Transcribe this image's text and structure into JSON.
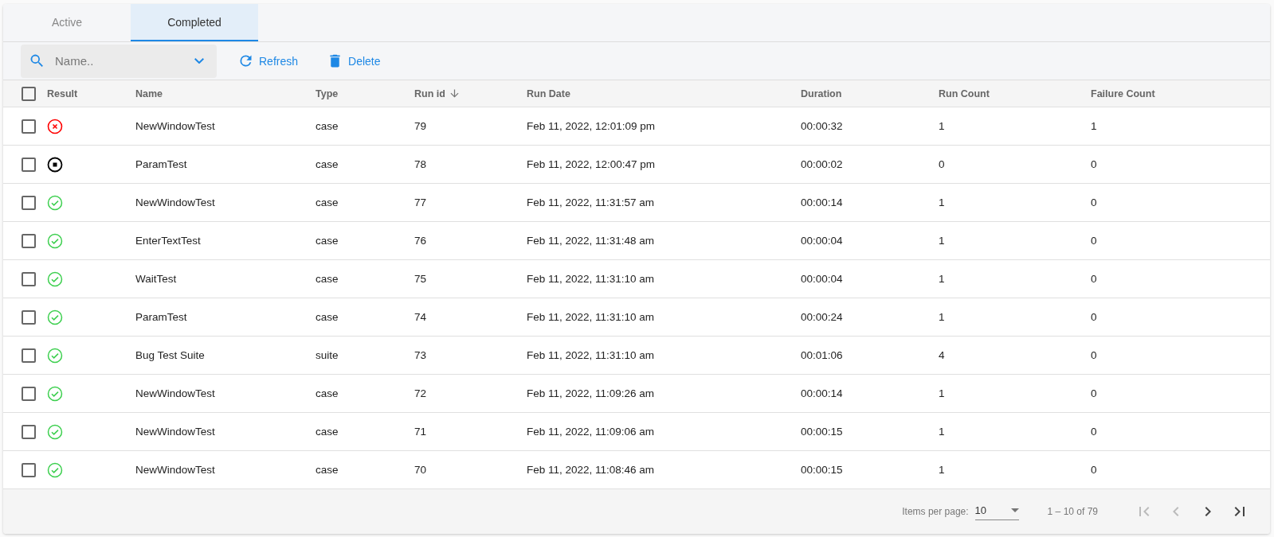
{
  "tabs": [
    {
      "label": "Active",
      "selected": false
    },
    {
      "label": "Completed",
      "selected": true
    }
  ],
  "toolbar": {
    "search": {
      "placeholder": "Name.."
    },
    "buttons": [
      {
        "kind": "refresh",
        "label": "Refresh"
      },
      {
        "kind": "delete",
        "label": "Delete"
      }
    ]
  },
  "table": {
    "select_all_checked": false,
    "columns": [
      "Result",
      "Name",
      "Type",
      "Run id",
      "Run Date",
      "Duration",
      "Run Count",
      "Failure Count"
    ],
    "rows": [
      {
        "checked": false,
        "kind": "failed",
        "name": "NewWindowTest",
        "type": "case",
        "run_id": "79",
        "run_date": "Feb 11, 2022, 12:01:09 pm",
        "duration": "00:00:32",
        "run_count": "1",
        "failure_count": "1"
      },
      {
        "checked": false,
        "kind": "stopped",
        "name": "ParamTest",
        "type": "case",
        "run_id": "78",
        "run_date": "Feb 11, 2022, 12:00:47 pm",
        "duration": "00:00:02",
        "run_count": "0",
        "failure_count": "0"
      },
      {
        "checked": false,
        "kind": "passed",
        "name": "NewWindowTest",
        "type": "case",
        "run_id": "77",
        "run_date": "Feb 11, 2022, 11:31:57 am",
        "duration": "00:00:14",
        "run_count": "1",
        "failure_count": "0"
      },
      {
        "checked": false,
        "kind": "passed",
        "name": "EnterTextTest",
        "type": "case",
        "run_id": "76",
        "run_date": "Feb 11, 2022, 11:31:48 am",
        "duration": "00:00:04",
        "run_count": "1",
        "failure_count": "0"
      },
      {
        "checked": false,
        "kind": "passed",
        "name": "WaitTest",
        "type": "case",
        "run_id": "75",
        "run_date": "Feb 11, 2022, 11:31:10 am",
        "duration": "00:00:04",
        "run_count": "1",
        "failure_count": "0"
      },
      {
        "checked": false,
        "kind": "passed",
        "name": "ParamTest",
        "type": "case",
        "run_id": "74",
        "run_date": "Feb 11, 2022, 11:31:10 am",
        "duration": "00:00:24",
        "run_count": "1",
        "failure_count": "0"
      },
      {
        "checked": false,
        "kind": "passed",
        "name": "Bug Test Suite",
        "type": "suite",
        "run_id": "73",
        "run_date": "Feb 11, 2022, 11:31:10 am",
        "duration": "00:01:06",
        "run_count": "4",
        "failure_count": "0"
      },
      {
        "checked": false,
        "kind": "passed",
        "name": "NewWindowTest",
        "type": "case",
        "run_id": "72",
        "run_date": "Feb 11, 2022, 11:09:26 am",
        "duration": "00:00:14",
        "run_count": "1",
        "failure_count": "0"
      },
      {
        "checked": false,
        "kind": "passed",
        "name": "NewWindowTest",
        "type": "case",
        "run_id": "71",
        "run_date": "Feb 11, 2022, 11:09:06 am",
        "duration": "00:00:15",
        "run_count": "1",
        "failure_count": "0"
      },
      {
        "checked": false,
        "kind": "passed",
        "name": "NewWindowTest",
        "type": "case",
        "run_id": "70",
        "run_date": "Feb 11, 2022, 11:08:46 am",
        "duration": "00:00:15",
        "run_count": "1",
        "failure_count": "0"
      }
    ]
  },
  "paginator": {
    "label": "Items per page:",
    "page_size": "10",
    "range": "1 – 10 of 79",
    "first_disabled": true,
    "prev_disabled": true,
    "next_disabled": false,
    "last_disabled": false
  }
}
